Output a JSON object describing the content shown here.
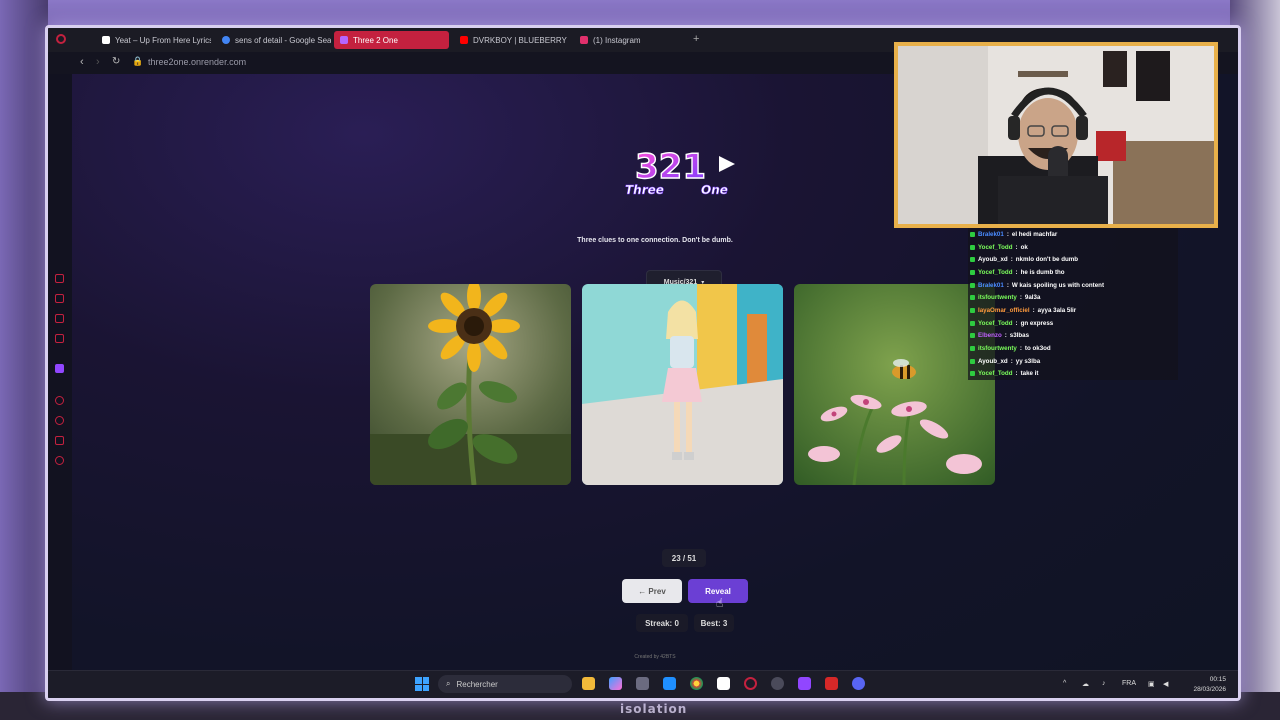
{
  "browser": {
    "tabs": [
      {
        "label": "Yeat – Up From Here Lyrics",
        "favicon_color": "#ffffff",
        "active": false
      },
      {
        "label": "sens of detail - Google Search",
        "favicon_color": "#4285f4",
        "active": false
      },
      {
        "label": "Three 2 One",
        "favicon_color": "#b565ff",
        "active": true
      },
      {
        "label": "DVRKBOY | BLUEBERRY",
        "favicon_color": "#ff0000",
        "active": false
      },
      {
        "label": "(1) Instagram",
        "favicon_color": "#e1306c",
        "active": false
      }
    ],
    "url": "three2one.onrender.com"
  },
  "app": {
    "logo_number": "321",
    "logo_word1": "Three",
    "logo_word2": "One",
    "tagline": "Three clues to one connection. Don't be dumb.",
    "category": "Music/321",
    "clues": [
      {
        "icon": "sunflower-image"
      },
      {
        "icon": "blonde-girl-image"
      },
      {
        "icon": "bee-on-flower-image"
      }
    ],
    "counter": "23 / 51",
    "prev_label": "← Prev",
    "reveal_label": "Reveal",
    "streak": "Streak: 0",
    "best": "Best: 3",
    "credit": "Created by 42BTS",
    "accent_color": "#6b3fd4"
  },
  "taskbar": {
    "search_placeholder": "Rechercher",
    "language": "FRA",
    "time": "00:15",
    "date": "28/03/2026"
  },
  "chat": [
    {
      "user": "Bralek01",
      "user_color": "#4a8bff",
      "message": "el hedi machfar"
    },
    {
      "user": "Yocef_Todd",
      "user_color": "#7cff5c",
      "message": "ok"
    },
    {
      "user": "Ayoub_xd",
      "user_color": "#ffffff",
      "message": "nkmlo don't be dumb"
    },
    {
      "user": "Yocef_Todd",
      "user_color": "#7cff5c",
      "message": "he is dumb tho"
    },
    {
      "user": "Bralek01",
      "user_color": "#4a8bff",
      "message": "W kais spoiling us with content"
    },
    {
      "user": "itsfourtwenty",
      "user_color": "#7cff5c",
      "message": "9al3a"
    },
    {
      "user": "IayaOmar_officiel",
      "user_color": "#ff9b3d",
      "message": "ayya 3ala 5lir"
    },
    {
      "user": "Yocef_Todd",
      "user_color": "#7cff5c",
      "message": "gn express"
    },
    {
      "user": "Elbenzo",
      "user_color": "#c060ff",
      "message": "s3lbas"
    },
    {
      "user": "itsfourtwenty",
      "user_color": "#7cff5c",
      "message": "to ok3od"
    },
    {
      "user": "Ayoub_xd",
      "user_color": "#ffffff",
      "message": "yy s3lba"
    },
    {
      "user": "Yocef_Todd",
      "user_color": "#7cff5c",
      "message": "take it"
    }
  ],
  "stream": {
    "bottom_logo": "isolation"
  }
}
